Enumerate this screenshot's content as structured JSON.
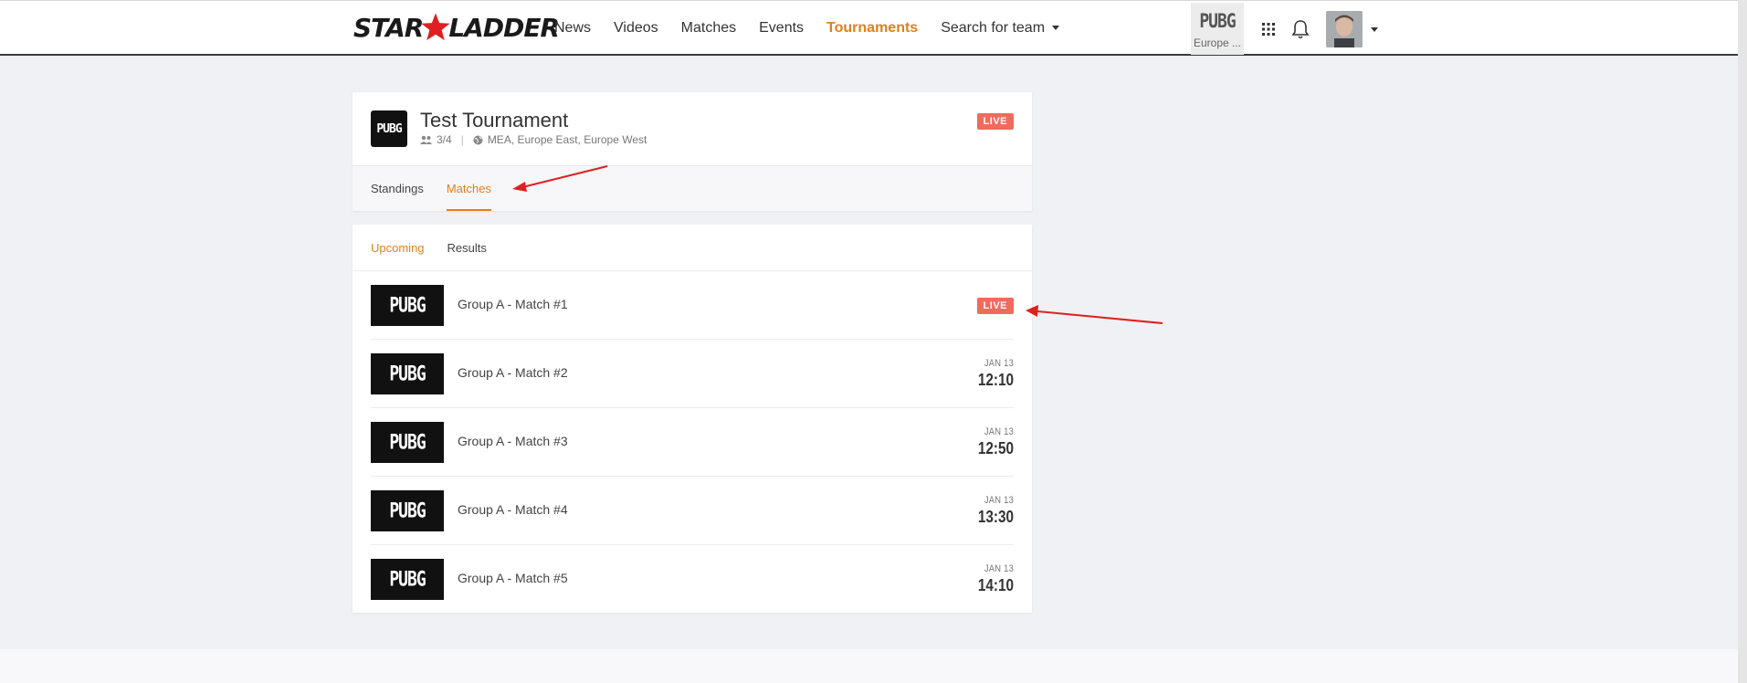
{
  "header": {
    "logo_left": "STAR",
    "logo_right": "LADDER",
    "nav": [
      {
        "label": "News",
        "active": false
      },
      {
        "label": "Videos",
        "active": false
      },
      {
        "label": "Matches",
        "active": false
      },
      {
        "label": "Events",
        "active": false
      },
      {
        "label": "Tournaments",
        "active": true
      },
      {
        "label": "Search for team",
        "active": false
      }
    ],
    "game": {
      "logo": "PUBG",
      "region": "Europe ..."
    }
  },
  "tournament": {
    "logo": "PUBG",
    "title": "Test Tournament",
    "teams": "3/4",
    "regions": "MEA, Europe East, Europe West",
    "status": "LIVE",
    "tabs": [
      {
        "label": "Standings",
        "active": false
      },
      {
        "label": "Matches",
        "active": true
      }
    ]
  },
  "matches": {
    "subtabs": [
      {
        "label": "Upcoming",
        "active": true
      },
      {
        "label": "Results",
        "active": false
      }
    ],
    "items": [
      {
        "logo": "PUBG",
        "name": "Group A - Match #1",
        "status": "LIVE",
        "date": "",
        "time": ""
      },
      {
        "logo": "PUBG",
        "name": "Group A - Match #2",
        "status": "",
        "date": "JAN 13",
        "time": "12:10"
      },
      {
        "logo": "PUBG",
        "name": "Group A - Match #3",
        "status": "",
        "date": "JAN 13",
        "time": "12:50"
      },
      {
        "logo": "PUBG",
        "name": "Group A - Match #4",
        "status": "",
        "date": "JAN 13",
        "time": "13:30"
      },
      {
        "logo": "PUBG",
        "name": "Group A - Match #5",
        "status": "",
        "date": "JAN 13",
        "time": "14:10"
      }
    ]
  },
  "colors": {
    "accent": "#e0801e",
    "live": "#ef6b5c",
    "annotation": "#e02020"
  }
}
